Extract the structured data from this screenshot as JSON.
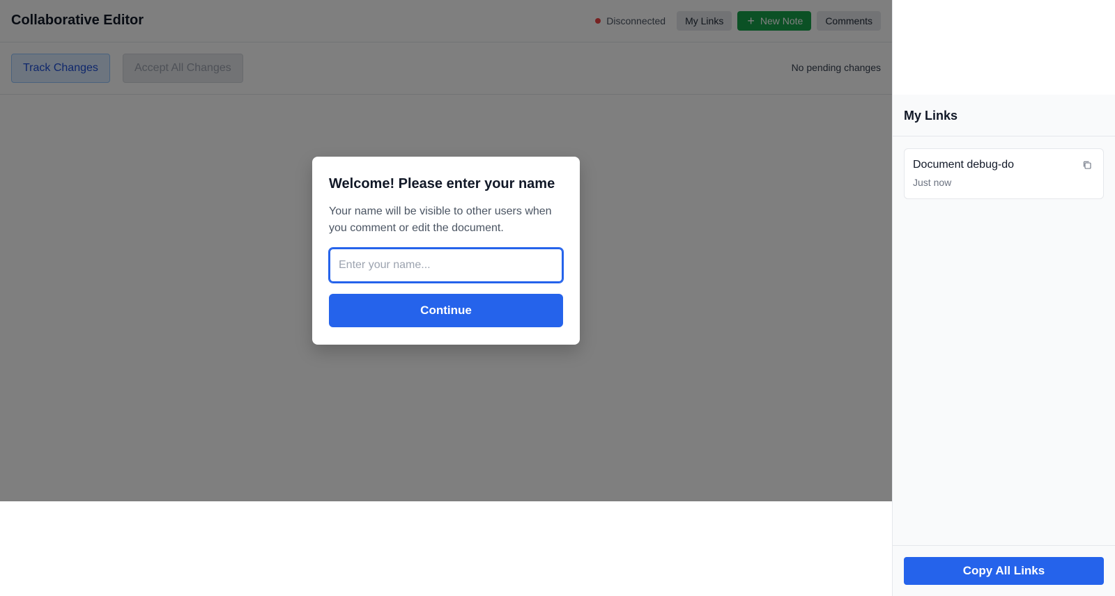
{
  "header": {
    "title": "Collaborative Editor",
    "status": "Disconnected",
    "status_color": "#ef4444",
    "my_links_label": "My Links",
    "new_note_label": "New Note",
    "comments_label": "Comments"
  },
  "toolbar": {
    "track_changes_label": "Track Changes",
    "accept_all_label": "Accept All Changes",
    "pending_text": "No pending changes"
  },
  "modal": {
    "title": "Welcome! Please enter your name",
    "description": "Your name will be visible to other users when you comment or edit the document.",
    "input_value": "",
    "input_placeholder": "Enter your name...",
    "continue_label": "Continue"
  },
  "panel": {
    "title": "My Links",
    "links": [
      {
        "title": "Document debug-do",
        "time": "Just now"
      }
    ],
    "copy_all_label": "Copy All Links"
  },
  "colors": {
    "accent": "#2563eb",
    "success": "#16a34a"
  }
}
